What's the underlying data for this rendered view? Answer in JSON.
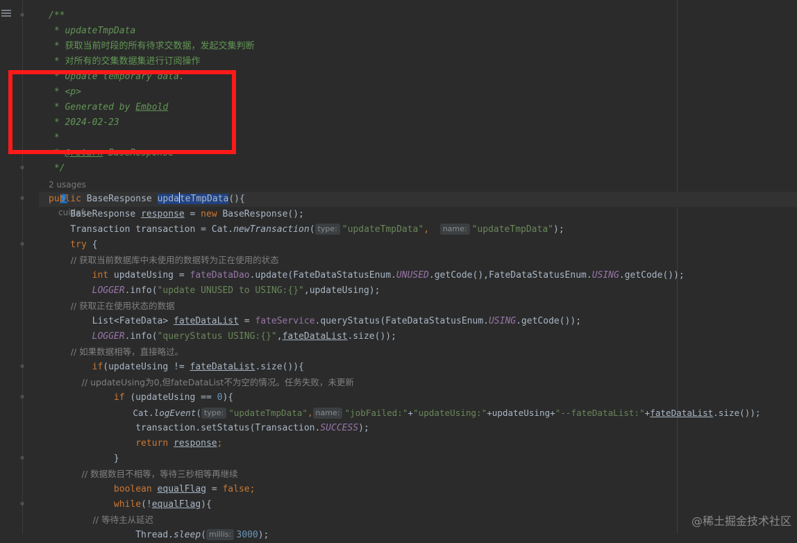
{
  "doc": {
    "open": "/**",
    "l1": " * updateTmpData",
    "l2": " * 获取当前时段的所有待求交数据，发起交集判断",
    "l3": " * 对所有的交集数据集进行订阅操作",
    "l4": " * Update temporary data.",
    "l5_prefix": " * ",
    "l5_tag": "<p>",
    "l6_prefix": " * Generated by ",
    "l6_name": "Embold",
    "l7": " * 2024-02-23",
    "l8": " *",
    "l9_prefix": " * ",
    "l9_tag": "@return",
    "l9_rest": " BaseResponse",
    "close": " */"
  },
  "usage": {
    "count": "2 usages",
    "author": "cuidefu"
  },
  "code": {
    "sig_public": "public ",
    "sig_type": "BaseResponse ",
    "sig_name_a": "upda",
    "sig_name_b": "teTmpData",
    "sig_rest": "(){",
    "l_resp_type": "    BaseResponse ",
    "l_resp_var": "response",
    "l_resp_eq": " = ",
    "l_resp_new": "new",
    "l_resp_rest": " BaseResponse();",
    "l_tx_a": "    Transaction transaction = Cat.",
    "l_tx_m": "newTransaction",
    "l_tx_p": "(",
    "hint_type": "type:",
    "l_tx_s1": "\"updateTmpData\"",
    "l_tx_c": ",  ",
    "hint_name": "name:",
    "l_tx_s2": "\"updateTmpData\"",
    "l_tx_end": ");",
    "l_try": "    try",
    "l_try_b": " {",
    "c1": "        // 获取当前数据库中未使用的数据转为正在使用的状态",
    "l_int": "        int",
    "l_int_v": " updateUsing = ",
    "l_int_f": "fateDataDao",
    "l_int_r1": ".update(FateDataStatusEnum.",
    "l_int_e1": "UNUSED",
    "l_int_r2": ".getCode(),FateDataStatusEnum.",
    "l_int_e2": "USING",
    "l_int_r3": ".getCode());",
    "l_log1_f": "        LOGGER",
    "l_log1_m": ".info(",
    "l_log1_s": "\"update UNUSED to USING:{}\"",
    "l_log1_r": ",updateUsing);",
    "c2": "        // 获取正在使用状态的数据",
    "l_list_a": "        List<FateData> ",
    "l_list_v": "fateDataList",
    "l_list_eq": " = ",
    "l_list_f": "fateService",
    "l_list_r1": ".queryStatus(FateDataStatusEnum.",
    "l_list_e": "USING",
    "l_list_r2": ".getCode());",
    "l_log2_f": "        LOGGER",
    "l_log2_m": ".info(",
    "l_log2_s": "\"queryStatus USING:{}\"",
    "l_log2_c": ",",
    "l_log2_v": "fateDataList",
    "l_log2_r": ".size());",
    "c3": "        // 如果数据相等，直接略过。",
    "l_if1_a": "        if",
    "l_if1_b": "(updateUsing != ",
    "l_if1_v": "fateDataList",
    "l_if1_c": ".size()){",
    "c4": "            // updateUsing为0,但fateDataList不为空的情况。任务失败，未更新",
    "l_if2_a": "            if",
    "l_if2_b": " (updateUsing == ",
    "l_if2_n": "0",
    "l_if2_c": "){",
    "l_ev_a": "                Cat.",
    "l_ev_m": "logEvent",
    "l_ev_p": "(",
    "l_ev_s1": "\"updateTmpData\"",
    "l_ev_c": ",",
    "l_ev_s2": "\"jobFailed:\"",
    "l_ev_plus1": "+",
    "l_ev_s3": "\"updateUsing:\"",
    "l_ev_plus2": "+updateUsing+",
    "l_ev_s4": "\"--fateDataList:\"",
    "l_ev_plus3": "+",
    "l_ev_v": "fateDataList",
    "l_ev_end": ".size());",
    "l_st_a": "                transaction.setStatus(Transaction.",
    "l_st_e": "SUCCESS",
    "l_st_end": ");",
    "l_ret_a": "                return",
    "l_ret_sp": " ",
    "l_ret_v": "response",
    "l_ret_end": ";",
    "l_close1": "            }",
    "c5": "            // 数据数目不相等，等待三秒相等再继续",
    "l_bool_a": "            boolean",
    "l_bool_sp": " ",
    "l_bool_v": "equalFlag",
    "l_bool_eq": " = ",
    "l_bool_f": "false",
    "l_bool_end": ";",
    "l_wh_a": "            while",
    "l_wh_b": "(!",
    "l_wh_v": "equalFlag",
    "l_wh_c": "){",
    "c6": "                // 等待主从延迟",
    "l_sleep_a": "                Thread.",
    "l_sleep_m": "sleep",
    "l_sleep_p": "(",
    "hint_millis": "millis:",
    "l_sleep_n": "3000",
    "l_sleep_end": ");"
  },
  "watermark": "@稀土掘金技术社区",
  "colors": {
    "annotation_box": "#ff1a1a",
    "background": "#2b2b2b",
    "selection": "#214283"
  }
}
